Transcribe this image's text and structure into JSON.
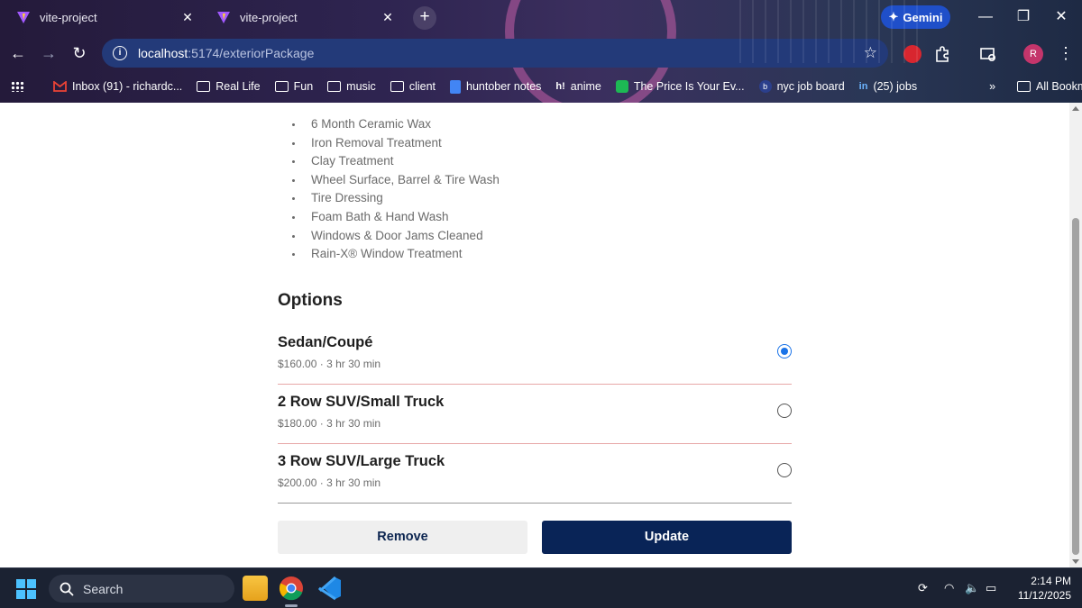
{
  "browser": {
    "tabs": [
      {
        "title": "vite-project",
        "close": "✕"
      },
      {
        "title": "vite-project",
        "close": "✕"
      }
    ],
    "new_tab": "+",
    "gemini_label": "Gemini",
    "address": {
      "host": "localhost",
      "path": ":5174/exteriorPackage"
    },
    "profile_initial": "R",
    "bookmarks": [
      {
        "label": "Inbox (91) - richardc..."
      },
      {
        "label": "Real Life"
      },
      {
        "label": "Fun"
      },
      {
        "label": "music"
      },
      {
        "label": "client"
      },
      {
        "label": "huntober notes"
      },
      {
        "label": "anime"
      },
      {
        "label": "The Price Is Your Ev..."
      },
      {
        "label": "nyc job board"
      },
      {
        "label": "(25) jobs"
      }
    ],
    "bookmarks_overflow": "»",
    "all_bookmarks": "All Bookmarks"
  },
  "page": {
    "features": [
      "6 Month Ceramic Wax",
      "Iron Removal Treatment",
      "Clay Treatment",
      "Wheel Surface, Barrel & Tire Wash",
      "Tire Dressing",
      "Foam Bath & Hand Wash",
      "Windows & Door Jams Cleaned",
      "Rain-X® Window Treatment"
    ],
    "options_title": "Options",
    "options": [
      {
        "name": "Sedan/Coupé",
        "price": "$160.00",
        "duration": "3 hr 30 min",
        "selected": true
      },
      {
        "name": "2 Row SUV/Small Truck",
        "price": "$180.00",
        "duration": "3 hr 30 min",
        "selected": false
      },
      {
        "name": "3 Row SUV/Large Truck",
        "price": "$200.00",
        "duration": "3 hr 30 min",
        "selected": false
      }
    ],
    "separator": "·",
    "remove_label": "Remove",
    "update_label": "Update"
  },
  "taskbar": {
    "search_placeholder": "Search",
    "time": "2:14 PM",
    "date": "11/12/2025"
  },
  "colors": {
    "accent_radio": "#1a73e8",
    "update_button": "#092457",
    "remove_button": "#efefef",
    "option_divider": "#e7a7a7"
  }
}
